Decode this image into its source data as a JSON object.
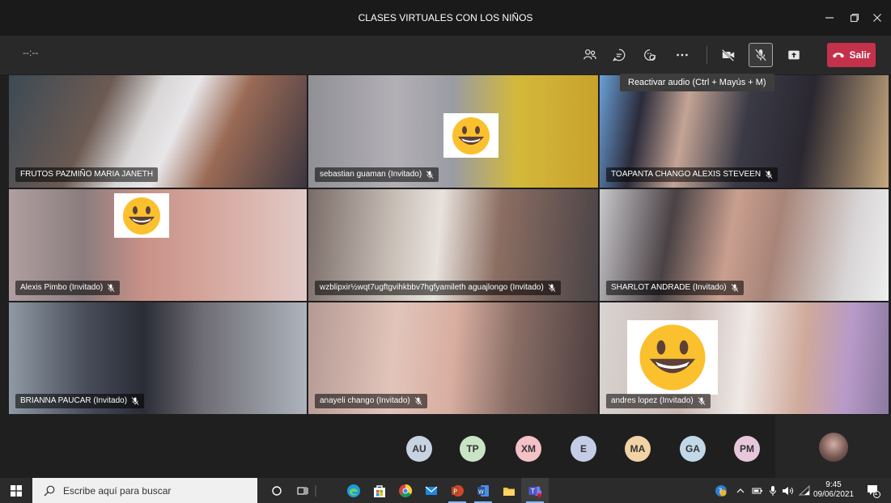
{
  "window": {
    "title": "CLASES VIRTUALES CON LOS NIÑOS"
  },
  "toolbar": {
    "timer": "--:--",
    "leave_label": "Salir",
    "tooltip": "Reactivar audio (Ctrl + Mayús + M)",
    "buttons": [
      "participants-icon",
      "chat-icon",
      "reactions-icon",
      "more-icon",
      "camera-off-icon",
      "mic-muted-icon",
      "share-icon"
    ]
  },
  "tiles": [
    {
      "name": "FRUTOS PAZMIÑO MARIA JANETH",
      "muted": false
    },
    {
      "name": "sebastian guaman (Invitado)",
      "muted": true
    },
    {
      "name": "TOAPANTA CHANGO ALEXIS STEVEEN",
      "muted": true
    },
    {
      "name": "Alexis Pimbo (Invitado)",
      "muted": true
    },
    {
      "name": "wzblipxir½wqt7ugftgvihkbbv7hgfyamileth aguajlongo (Invitado)",
      "muted": true
    },
    {
      "name": "SHARLOT ANDRADE (Invitado)",
      "muted": true
    },
    {
      "name": "BRIANNA PAUCAR (Invitado)",
      "muted": true
    },
    {
      "name": "anayeli chango (Invitado)",
      "muted": true
    },
    {
      "name": "andres lopez (Invitado)",
      "muted": true
    }
  ],
  "participants": [
    {
      "initials": "AU",
      "color": "#c7d3e0"
    },
    {
      "initials": "TP",
      "color": "#c9e4c5"
    },
    {
      "initials": "XM",
      "color": "#f3c1c6"
    },
    {
      "initials": "E",
      "color": "#c5cde6"
    },
    {
      "initials": "MA",
      "color": "#f2d3a6"
    },
    {
      "initials": "GA",
      "color": "#c1d8e6"
    },
    {
      "initials": "PM",
      "color": "#e6c7dc"
    }
  ],
  "taskbar": {
    "search_placeholder": "Escribe aquí para buscar",
    "time": "9:45",
    "date": "09/06/2021",
    "notification_count": "1"
  }
}
